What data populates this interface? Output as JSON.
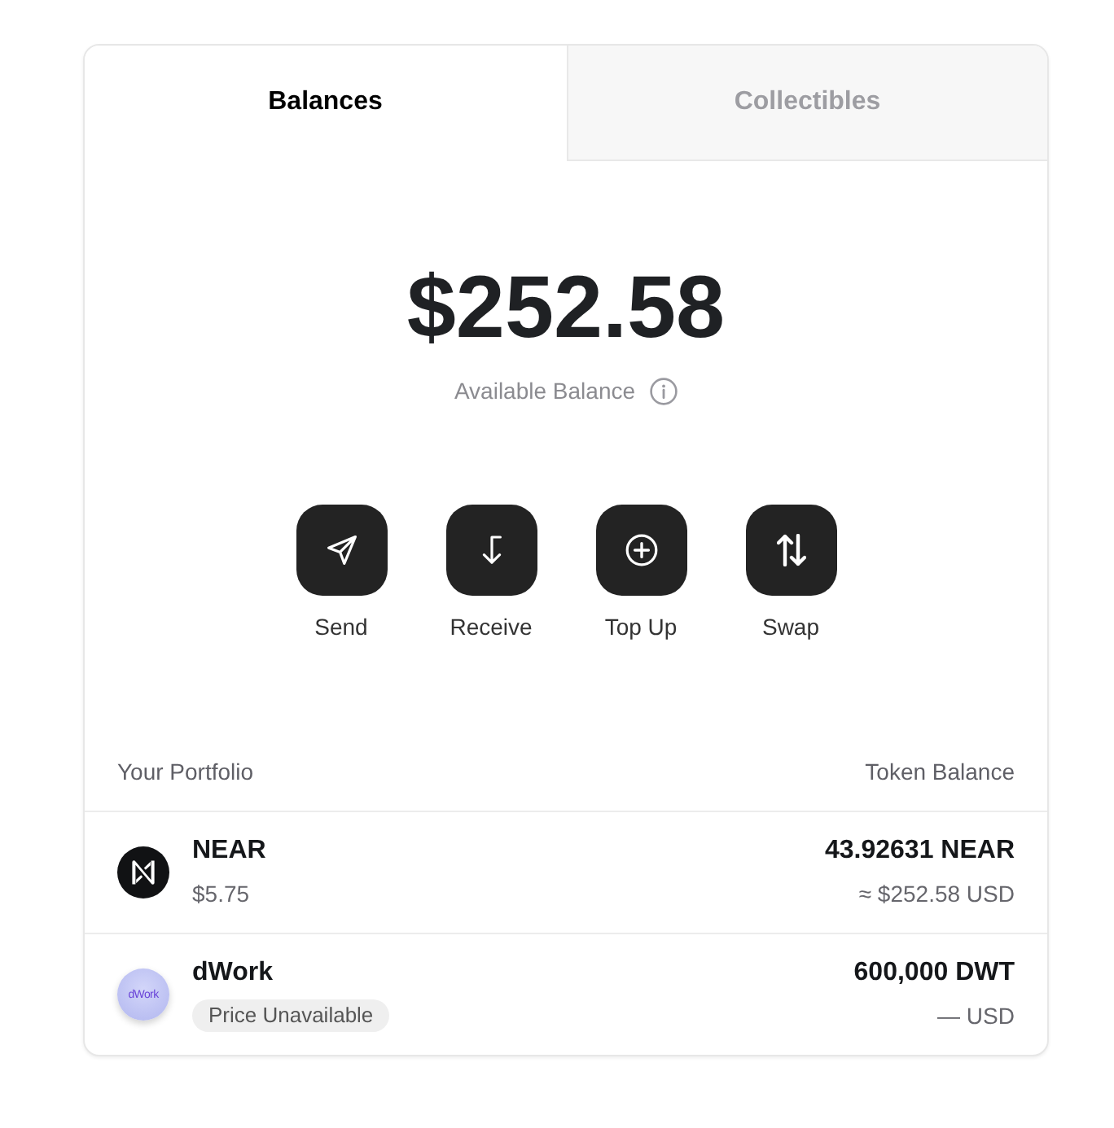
{
  "tabs": [
    {
      "label": "Balances",
      "selected": true
    },
    {
      "label": "Collectibles",
      "selected": false
    }
  ],
  "balance": {
    "amount": "$252.58",
    "label": "Available Balance"
  },
  "actions": [
    {
      "kind": "send",
      "label": "Send"
    },
    {
      "kind": "receive",
      "label": "Receive"
    },
    {
      "kind": "top_up",
      "label": "Top Up"
    },
    {
      "kind": "swap",
      "label": "Swap"
    }
  ],
  "portfolio": {
    "columns": [
      "Your Portfolio",
      "Token Balance"
    ],
    "tokens": [
      {
        "name": "NEAR",
        "logo": {
          "kind": "mark"
        },
        "price": "$5.75",
        "price_available": true,
        "balance": "43.92631 NEAR",
        "usd_value": "≈ $252.58 USD"
      },
      {
        "name": "dWork",
        "logo": {
          "kind": "wordmark",
          "text": "dWork"
        },
        "price": "Price Unavailable",
        "price_available": false,
        "balance": "600,000 DWT",
        "usd_value": "— USD"
      }
    ]
  }
}
